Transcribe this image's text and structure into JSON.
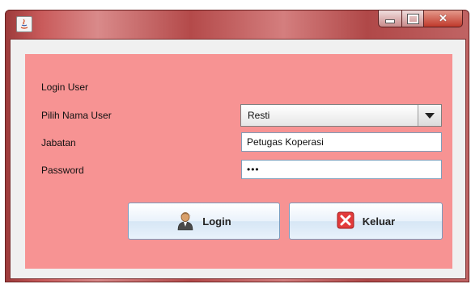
{
  "window": {
    "title": ""
  },
  "form": {
    "heading": "Login User",
    "username_label": "Pilih Nama User",
    "username_selected": "Resti",
    "jabatan_label": "Jabatan",
    "jabatan_value": "Petugas Koperasi",
    "password_label": "Password",
    "password_mask": "•••"
  },
  "buttons": {
    "login_label": "Login",
    "keluar_label": "Keluar"
  },
  "icons": {
    "app": "java-app-icon",
    "login": "user-icon",
    "keluar": "close-x-icon",
    "minimize": "minimize-icon",
    "maximize": "maximize-icon",
    "close": "close-icon",
    "dropdown": "chevron-down-icon"
  },
  "colors": {
    "panel": "#f79393",
    "titlebar": "#c05a5a"
  }
}
